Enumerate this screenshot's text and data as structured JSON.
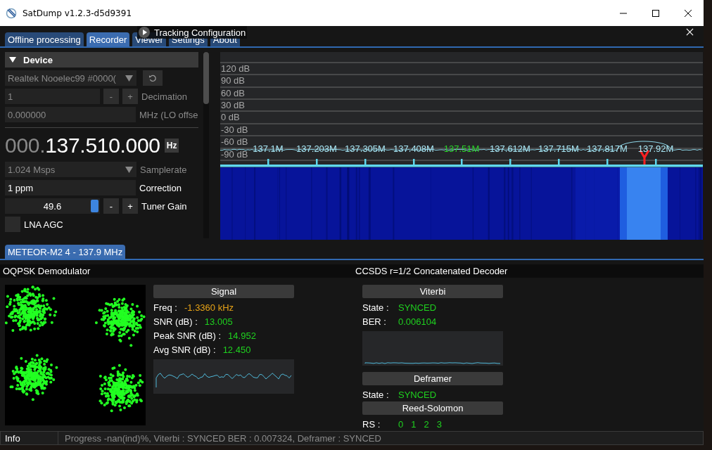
{
  "window": {
    "title": "SatDump v1.2.3-d5d9391"
  },
  "tabs": [
    {
      "label": "Offline processing",
      "selected": false
    },
    {
      "label": "Recorder",
      "selected": true
    },
    {
      "label": "Viewer",
      "selected": false
    },
    {
      "label": "Settings",
      "selected": false
    },
    {
      "label": "About",
      "selected": false
    }
  ],
  "popup": {
    "title": "Tracking Configuration"
  },
  "device": {
    "header": "Device",
    "expanded": true,
    "source": {
      "value": "Realtek Nooelec99 #0000(",
      "disabled": true
    },
    "decimation": {
      "value": "1",
      "label": "Decimation",
      "buttons": [
        "-",
        "+"
      ],
      "disabled": true
    },
    "lo_offset": {
      "value": "0.000000",
      "label": "MHz (LO offse",
      "disabled": true
    },
    "frequency": {
      "leading": "000.",
      "value": "137.510.000",
      "unit": "Hz"
    },
    "samplerate": {
      "value": "1.024 Msps",
      "label": "Samplerate",
      "disabled": true
    },
    "correction": {
      "value": "1 ppm",
      "label": "Correction",
      "disabled": false
    },
    "gain": {
      "value": "49.6",
      "level": 1,
      "label": "Tuner Gain",
      "buttons": [
        "-",
        "+"
      ]
    },
    "lna_agc": {
      "label": "LNA AGC",
      "checked": false
    }
  },
  "spectrum": {
    "db_labels": [
      "120 dB",
      "90 dB",
      "60 dB",
      "30 dB",
      "0 dB",
      "-30 dB",
      "-60 dB",
      "-90 dB"
    ],
    "freq_labels": [
      {
        "text": "137.1M",
        "selected": false
      },
      {
        "text": "137.203M",
        "selected": false
      },
      {
        "text": "137.305M",
        "selected": false
      },
      {
        "text": "137.408M",
        "selected": false
      },
      {
        "text": "137.51M",
        "selected": true
      },
      {
        "text": "137.612M",
        "selected": false
      },
      {
        "text": "137.715M",
        "selected": false
      },
      {
        "text": "137.817M",
        "selected": false
      },
      {
        "text": "137.92M",
        "selected": false
      }
    ]
  },
  "pipeline_tab": {
    "label": "METEOR-M2 4 - 137.9 MHz",
    "selected": true
  },
  "demodulator": {
    "title": "OQPSK Demodulator",
    "signal_header": "Signal",
    "stats": [
      {
        "label": "Freq :",
        "value": "-1.3360 kHz",
        "color": "#e8a317"
      },
      {
        "label": "SNR (dB) :",
        "value": "13.005",
        "color": "#1fd11f"
      },
      {
        "label": "Peak SNR (dB) :",
        "value": "14.952",
        "color": "#1fd11f"
      },
      {
        "label": "Avg SNR (dB) :",
        "value": "12.450",
        "color": "#1fd11f"
      }
    ]
  },
  "decoder": {
    "title": "CCSDS r=1/2 Concatenated Decoder",
    "sections": [
      {
        "header": "Viterbi",
        "graph": true,
        "rows": [
          {
            "label": "State :",
            "values": [
              "SYNCED"
            ]
          },
          {
            "label": "BER  :",
            "values": [
              "0.006104"
            ]
          }
        ]
      },
      {
        "header": "Deframer",
        "rows": [
          {
            "label": "State :",
            "values": [
              "SYNCED"
            ]
          }
        ]
      },
      {
        "header": "Reed-Solomon",
        "rows": [
          {
            "label": "RS  :",
            "values": [
              "0",
              "1",
              "2",
              "3"
            ]
          }
        ]
      }
    ]
  },
  "status_bar": {
    "label": "Info",
    "text": "Progress -nan(ind)%, Viterbi : SYNCED BER : 0.007324, Deframer : SYNCED"
  }
}
